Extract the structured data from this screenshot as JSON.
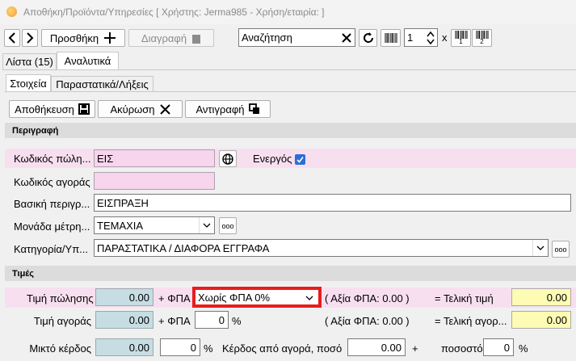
{
  "window": {
    "title": "Αποθήκη/Προϊόντα/Υπηρεσίες   [ Χρήστης: Jerma985 - Χρήση/εταιρία:  ]"
  },
  "toolbar": {
    "add_label": "Προσθήκη",
    "delete_label": "Διαγραφή",
    "search_placeholder": "Αναζήτηση",
    "quantity": "1",
    "times": "x",
    "barcode1_sub": "1",
    "barcode2_sub": "2"
  },
  "main_tabs": [
    {
      "label": "Λίστα (15)"
    },
    {
      "label": "Αναλυτικά"
    }
  ],
  "sub_tabs": [
    {
      "label": "Στοιχεία"
    },
    {
      "label": "Παραστατικά/Λήξεις"
    }
  ],
  "actions": {
    "save": "Αποθήκευση",
    "cancel": "Ακύρωση",
    "copy": "Αντιγραφή"
  },
  "description_section": {
    "title": "Περιγραφή",
    "sale_code_label": "Κωδικός πώλη...",
    "sale_code": "ΕΙΣ",
    "active_label": "Ενεργός",
    "active_checked": true,
    "purchase_code_label": "Κωδικός αγοράς",
    "purchase_code": "",
    "main_desc_label": "Βασική περιγρ...",
    "main_desc": "ΕΙΣΠΡΑΞΗ",
    "unit_label": "Μονάδα μέτρη...",
    "unit": "ΤΕΜΑΧΙΑ",
    "category_label": "Κατηγορία/Υπ...",
    "category": "ΠΑΡΑΣΤΑΤΙΚΑ / ΔΙΑΦΟΡΑ ΕΓΓΡΑΦΑ",
    "more": "ooo"
  },
  "prices_section": {
    "title": "Τιμές",
    "sale_price_label": "Τιμή πώλησης",
    "sale_price": "0.00",
    "plus_vat": "+ ΦΠΑ",
    "vat_option": "Χωρίς ΦΠΑ 0%",
    "vat_value_1": "( Αξία ΦΠΑ: 0.00 )",
    "final_price_label": "= Τελική τιμή",
    "final_price": "0.00",
    "purchase_price_label": "Τιμή αγοράς",
    "purchase_price": "0.00",
    "purchase_vat": "0",
    "percent": "%",
    "vat_value_2": "( Αξία ΦΠΑ: 0.00 )",
    "final_purchase_label": "= Τελική αγορ...",
    "final_purchase": "0.00",
    "gross_profit_label": "Μικτό κέρδος",
    "gross_profit": "0.00",
    "gross_profit_pct": "0",
    "profit_from_purchase_label": "Κέρδος από αγορά, ποσό",
    "profit_amount": "0.00",
    "plus": "+",
    "pct_label": "ποσοστό",
    "profit_pct": "0"
  },
  "colors": {
    "highlight": "#e81c1c",
    "pink_row": "#f8dff0",
    "blue_field": "#c6dde3",
    "yellow_field": "#fdfbb4"
  }
}
